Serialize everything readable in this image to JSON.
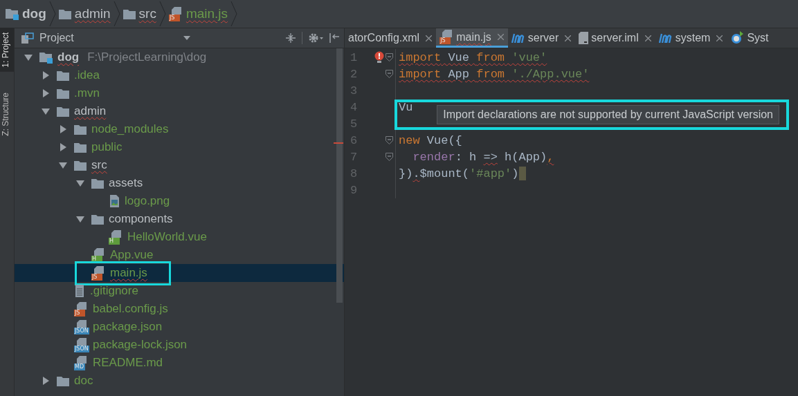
{
  "breadcrumb": [
    {
      "label": "dog",
      "kind": "module",
      "error_underline": false
    },
    {
      "label": "admin",
      "kind": "folder",
      "error_underline": true
    },
    {
      "label": "src",
      "kind": "folder",
      "error_underline": true
    },
    {
      "label": "main.js",
      "kind": "js",
      "badge": "JS",
      "error_underline": true
    }
  ],
  "tool_strip": [
    {
      "label": "1: Project",
      "selected": true
    },
    {
      "label": "Z: Structure",
      "selected": false
    }
  ],
  "project_panel": {
    "title": "Project",
    "tree": [
      {
        "label": "dog",
        "path": "F:\\ProjectLearning\\dog",
        "kind": "module",
        "expanded": true,
        "selected": false,
        "error_underline": true,
        "children": [
          {
            "label": ".idea",
            "kind": "folder",
            "expanded": false,
            "selected": false,
            "error_underline": false
          },
          {
            "label": ".mvn",
            "kind": "folder",
            "expanded": false,
            "selected": false,
            "error_underline": false
          },
          {
            "label": "admin",
            "kind": "folder",
            "expanded": true,
            "selected": false,
            "error_underline": true,
            "children": [
              {
                "label": "node_modules",
                "kind": "folder",
                "expanded": false,
                "selected": false,
                "error_underline": false
              },
              {
                "label": "public",
                "kind": "folder",
                "expanded": false,
                "selected": false,
                "error_underline": false
              },
              {
                "label": "src",
                "kind": "folder",
                "expanded": true,
                "selected": false,
                "error_underline": true,
                "children": [
                  {
                    "label": "assets",
                    "kind": "folder",
                    "expanded": true,
                    "selected": false,
                    "error_underline": false,
                    "children": [
                      {
                        "label": "logo.png",
                        "kind": "image",
                        "selected": false,
                        "error_underline": false
                      }
                    ]
                  },
                  {
                    "label": "components",
                    "kind": "folder",
                    "expanded": true,
                    "selected": false,
                    "error_underline": false,
                    "children": [
                      {
                        "label": "HelloWorld.vue",
                        "kind": "vue",
                        "badge": "H",
                        "selected": false,
                        "error_underline": false
                      }
                    ]
                  },
                  {
                    "label": "App.vue",
                    "kind": "vue",
                    "badge": "H",
                    "selected": false,
                    "error_underline": false
                  },
                  {
                    "label": "main.js",
                    "kind": "js",
                    "badge": "JS",
                    "selected": true,
                    "error_underline": true
                  }
                ]
              },
              {
                "label": ".gitignore",
                "kind": "text",
                "selected": false,
                "error_underline": false
              },
              {
                "label": "babel.config.js",
                "kind": "js",
                "badge": "JS",
                "selected": false,
                "error_underline": false
              },
              {
                "label": "package.json",
                "kind": "json",
                "badge": "JSON",
                "selected": false,
                "error_underline": false
              },
              {
                "label": "package-lock.json",
                "kind": "json",
                "badge": "JSON",
                "selected": false,
                "error_underline": false
              },
              {
                "label": "README.md",
                "kind": "md",
                "badge": "MD",
                "selected": false,
                "error_underline": false
              }
            ]
          },
          {
            "label": "doc",
            "kind": "folder",
            "expanded": false,
            "selected": false,
            "error_underline": false
          }
        ]
      }
    ]
  },
  "editor_tabs": [
    {
      "label": "atorConfig.xml",
      "kind": "xml",
      "selected": false,
      "error_underline": false
    },
    {
      "label": "main.js",
      "kind": "js",
      "badge": "JS",
      "selected": true,
      "error_underline": true
    },
    {
      "label": "server",
      "kind": "module",
      "selected": false,
      "error_underline": false
    },
    {
      "label": "server.iml",
      "kind": "iml",
      "selected": false,
      "error_underline": false
    },
    {
      "label": "system",
      "kind": "module",
      "selected": false,
      "error_underline": false
    },
    {
      "label": "Syst",
      "kind": "service",
      "selected": false,
      "error_underline": false
    }
  ],
  "code_lines": [
    {
      "number": "1",
      "fold": true,
      "tokens": [
        {
          "text": "import",
          "kind": "keyword",
          "error": true
        },
        {
          "text": " Vue ",
          "kind": "plain",
          "error": true
        },
        {
          "text": "from",
          "kind": "keyword",
          "error": true
        },
        {
          "text": " 'vue'",
          "kind": "string",
          "error": true
        }
      ]
    },
    {
      "number": "2",
      "fold": true,
      "tokens": [
        {
          "text": "import",
          "kind": "keyword",
          "error": true
        },
        {
          "text": " App ",
          "kind": "plain",
          "error": true
        },
        {
          "text": "from",
          "kind": "keyword",
          "error": true
        },
        {
          "text": " './App.vue'",
          "kind": "string",
          "error": true
        }
      ]
    },
    {
      "number": "3",
      "fold": false
    },
    {
      "number": "4",
      "fold": false,
      "tokens": [
        {
          "text": "Vu",
          "kind": "plain",
          "error": false
        }
      ]
    },
    {
      "number": "5",
      "fold": false
    },
    {
      "number": "6",
      "fold": true,
      "tokens": [
        {
          "text": "new",
          "kind": "keyword",
          "error": false
        },
        {
          "text": " Vue({",
          "kind": "plain",
          "error": false
        }
      ]
    },
    {
      "number": "7",
      "fold": true,
      "tokens": [
        {
          "text": "  render",
          "kind": "field",
          "error": false
        },
        {
          "text": ": h ",
          "kind": "plain",
          "error": false
        },
        {
          "text": "=>",
          "kind": "plain",
          "error": true
        },
        {
          "text": " h(App)",
          "kind": "plain",
          "error": false
        },
        {
          "text": ",",
          "kind": "keyword",
          "error": true
        }
      ]
    },
    {
      "number": "8",
      "fold": false,
      "tokens": [
        {
          "text": "})",
          "kind": "plain",
          "error": false
        },
        {
          "text": ".",
          "kind": "plain",
          "error": true
        },
        {
          "text": "$mount(",
          "kind": "plain",
          "error": false
        },
        {
          "text": "'#app'",
          "kind": "string",
          "error": false
        },
        {
          "text": ")",
          "kind": "plain",
          "error": false
        }
      ]
    },
    {
      "number": "9",
      "fold": false
    }
  ],
  "tooltip": {
    "text": "Import declarations are not supported by current JavaScript version"
  }
}
